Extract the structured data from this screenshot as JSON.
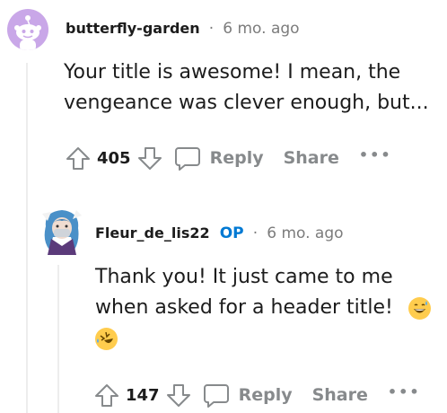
{
  "comment1": {
    "username": "butterfly-garden",
    "separator": "·",
    "time": "6 mo. ago",
    "text_line1": "Your title is awesome! I mean, the",
    "text_line2": "vengeance was clever enough, but...",
    "votes": "405",
    "reply_label": "Reply",
    "share_label": "Share",
    "more": "•••"
  },
  "comment2": {
    "username": "Fleur_de_lis22",
    "op_badge": "OP",
    "separator": "·",
    "time": "6 mo. ago",
    "text_line1": "Thank you! It just came to me",
    "text_line2": "when asked for a header title!",
    "emoji1": "grinning-sweat-emoji",
    "emoji2": "rolling-laughing-emoji",
    "votes": "147",
    "reply_label": "Reply",
    "share_label": "Share",
    "more": "•••"
  },
  "colors": {
    "username": "#1c1c1c",
    "meta": "#7c7c7c",
    "op": "#0079d3",
    "action": "#878a8c",
    "avatar1_bg": "#c9a7e8",
    "thread_line": "#ededed"
  }
}
